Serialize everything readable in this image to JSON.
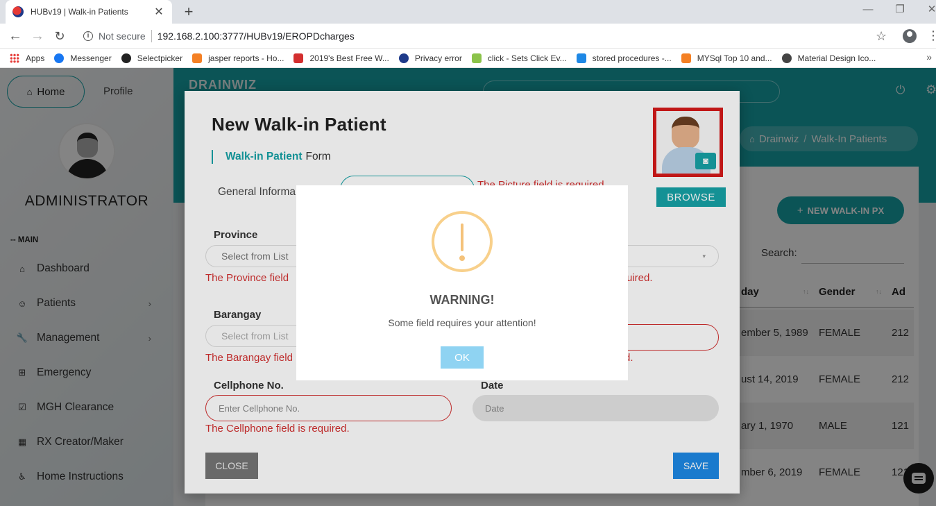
{
  "browser": {
    "tab_title": "HUBv19 | Walk-in Patients",
    "new_tab": "+",
    "close_tab": "✕",
    "minimize": "—",
    "restore": "❐",
    "close_window": "✕",
    "security_label": "Not secure",
    "url": "192.168.2.100:3777/HUBv19/EROPDcharges",
    "bookmarks": [
      {
        "label": "Apps",
        "icon": "apps-grid-icon"
      },
      {
        "label": "Messenger",
        "icon": "messenger-icon",
        "color": "#1877f2"
      },
      {
        "label": "Selectpicker",
        "icon": "github-icon",
        "color": "#222222"
      },
      {
        "label": "jasper reports - Ho...",
        "icon": "stackoverflow-icon",
        "color": "#f48024"
      },
      {
        "label": "2019's Best Free W...",
        "icon": "swirl-icon",
        "color": "#d32f2f"
      },
      {
        "label": "Privacy error",
        "icon": "globe-icon",
        "color": "#1e3a8a"
      },
      {
        "label": "click - Sets Click Ev...",
        "icon": "spark-icon",
        "color": "#8bc34a"
      },
      {
        "label": "stored procedures -...",
        "icon": "database-icon",
        "color": "#1e88e5"
      },
      {
        "label": "MYSql Top 10 and...",
        "icon": "stackoverflow-icon",
        "color": "#f48024"
      },
      {
        "label": "Material Design Ico...",
        "icon": "globe-icon",
        "color": "#444444"
      }
    ],
    "more": "»"
  },
  "sidebar": {
    "home": "Home",
    "profile": "Profile",
    "user_name": "ADMINISTRATOR",
    "section": "-- MAIN",
    "items": [
      {
        "label": "Dashboard",
        "icon": "home-icon",
        "chevron": false
      },
      {
        "label": "Patients",
        "icon": "smiley-icon",
        "chevron": true
      },
      {
        "label": "Management",
        "icon": "wrench-icon",
        "chevron": true
      },
      {
        "label": "Emergency",
        "icon": "plus-square-icon",
        "chevron": false
      },
      {
        "label": "MGH Clearance",
        "icon": "checkbox-icon",
        "chevron": false
      },
      {
        "label": "RX Creator/Maker",
        "icon": "grid-icon",
        "chevron": false
      },
      {
        "label": "Home Instructions",
        "icon": "wheelchair-icon",
        "chevron": false
      }
    ]
  },
  "topbar": {
    "brand": "DRAINWIZ",
    "breadcrumb": [
      "Drainwiz",
      "/",
      "Walk-In Patients"
    ]
  },
  "page": {
    "new_button": "NEW WALK-IN PX",
    "search_label": "Search:",
    "columns": [
      "day",
      "Gender",
      "Ad"
    ],
    "rows": [
      [
        "ember 5, 1989",
        "FEMALE",
        "212"
      ],
      [
        "ust 14, 2019",
        "FEMALE",
        "212"
      ],
      [
        "ary 1, 1970",
        "MALE",
        "121"
      ],
      [
        "mber 6, 2019",
        "FEMALE",
        "121"
      ]
    ]
  },
  "modal": {
    "title": "New Walk-in Patient",
    "form_tag_bold": "Walk-in Patient",
    "form_tag_rest": "Form",
    "tab_general": "General Informa",
    "picture_error": "The Picture field is required.",
    "browse": "BROWSE",
    "province_label": "Province",
    "province_placeholder": "Select from List",
    "province_error": "The Province field",
    "right_error_1": "uired.",
    "barangay_label": "Barangay",
    "barangay_placeholder": "Select from List",
    "barangay_error": "The Barangay field",
    "right_error_2": "d.",
    "cellphone_label": "Cellphone No.",
    "cellphone_placeholder": "Enter Cellphone No.",
    "cellphone_error": "The Cellphone field is required.",
    "date_label": "Date",
    "date_placeholder": "Date",
    "close": "CLOSE",
    "save": "SAVE"
  },
  "alert": {
    "title": "WARNING!",
    "message": "Some field requires your attention!",
    "ok": "OK"
  }
}
